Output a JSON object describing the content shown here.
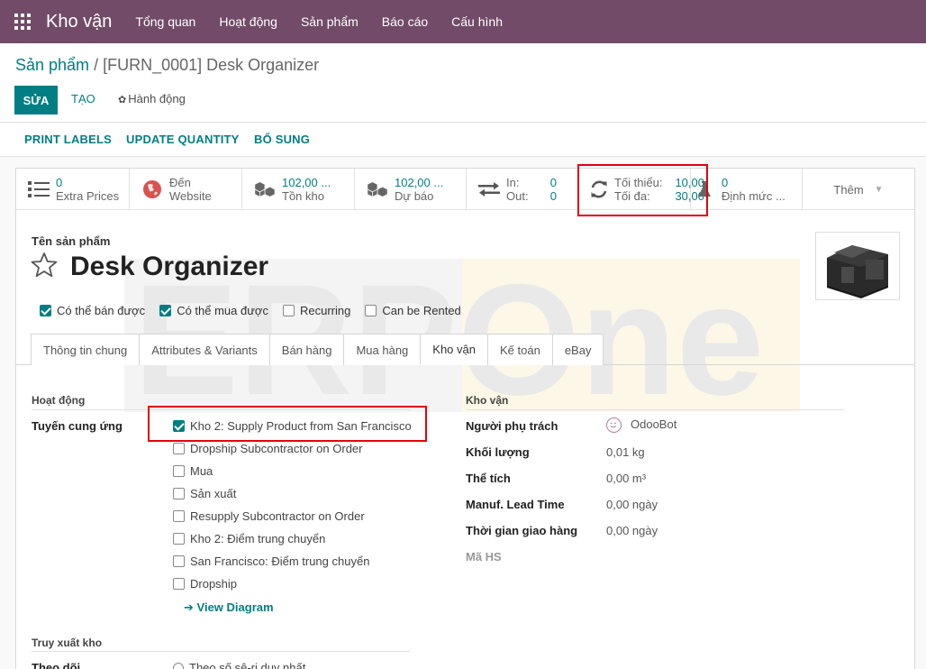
{
  "navbar": {
    "brand": "Kho vận",
    "items": [
      "Tổng quan",
      "Hoạt động",
      "Sản phẩm",
      "Báo cáo",
      "Cấu hình"
    ]
  },
  "breadcrumb": {
    "parent": "Sản phẩm",
    "separator": " / ",
    "current": "[FURN_0001] Desk Organizer"
  },
  "control": {
    "edit": "SỬA",
    "create": "TẠO",
    "action": "Hành động"
  },
  "header_buttons": [
    "PRINT LABELS",
    "UPDATE QUANTITY",
    "BỔ SUNG"
  ],
  "smart_buttons": {
    "extra_prices": {
      "value": "0",
      "label": "Extra Prices"
    },
    "website": {
      "value": "Đến",
      "label": "Website"
    },
    "on_hand": {
      "value": "102,00 ...",
      "label": "Tồn kho"
    },
    "forecast": {
      "value": "102,00 ...",
      "label": "Dự báo"
    },
    "in_out": {
      "in_label": "In:",
      "in_value": "0",
      "out_label": "Out:",
      "out_value": "0"
    },
    "reorder": {
      "min_label": "Tối thiểu:",
      "min_value": "10,00",
      "max_label": "Tối đa:",
      "max_value": "30,00"
    },
    "bom": {
      "value": "0",
      "label": "Định mức ..."
    },
    "more": "Thêm"
  },
  "product": {
    "name_label": "Tên sản phẩm",
    "name": "Desk Organizer",
    "options": [
      {
        "label": "Có thể bán được",
        "checked": true
      },
      {
        "label": "Có thể mua được",
        "checked": true
      },
      {
        "label": "Recurring",
        "checked": false
      },
      {
        "label": "Can be Rented",
        "checked": false
      }
    ]
  },
  "tabs": [
    "Thông tin chung",
    "Attributes & Variants",
    "Bán hàng",
    "Mua hàng",
    "Kho vận",
    "Kế toán",
    "eBay"
  ],
  "operations": {
    "title": "Hoạt động",
    "routes_label": "Tuyến cung ứng",
    "routes": [
      {
        "label": "Kho 2: Supply Product from San Francisco",
        "checked": true
      },
      {
        "label": "Dropship Subcontractor on Order",
        "checked": false
      },
      {
        "label": "Mua",
        "checked": false
      },
      {
        "label": "Sản xuất",
        "checked": false
      },
      {
        "label": "Resupply Subcontractor on Order",
        "checked": false
      },
      {
        "label": "Kho 2: Điểm trung chuyển",
        "checked": false
      },
      {
        "label": "San Francisco: Điểm trung chuyển",
        "checked": false
      },
      {
        "label": "Dropship",
        "checked": false
      }
    ],
    "view_diagram": "View Diagram"
  },
  "logistics": {
    "title": "Kho vận",
    "responsible_label": "Người phụ trách",
    "responsible": "OdooBot",
    "weight_label": "Khối lượng",
    "weight": "0,01 kg",
    "volume_label": "Thể tích",
    "volume": "0,00 m³",
    "lead_label": "Manuf. Lead Time",
    "lead": "0,00 ngày",
    "delivery_label": "Thời gian giao hàng",
    "delivery": "0,00 ngày",
    "hs_label": "Mã HS"
  },
  "traceability": {
    "title": "Truy xuất kho",
    "tracking_label": "Theo dõi",
    "tracking_option": "Theo số sê-ri duy nhất"
  },
  "watermark": "ERPOne",
  "colors": {
    "navbar": "#714b67",
    "primary": "#017e84",
    "highlight": "#e4000f"
  }
}
